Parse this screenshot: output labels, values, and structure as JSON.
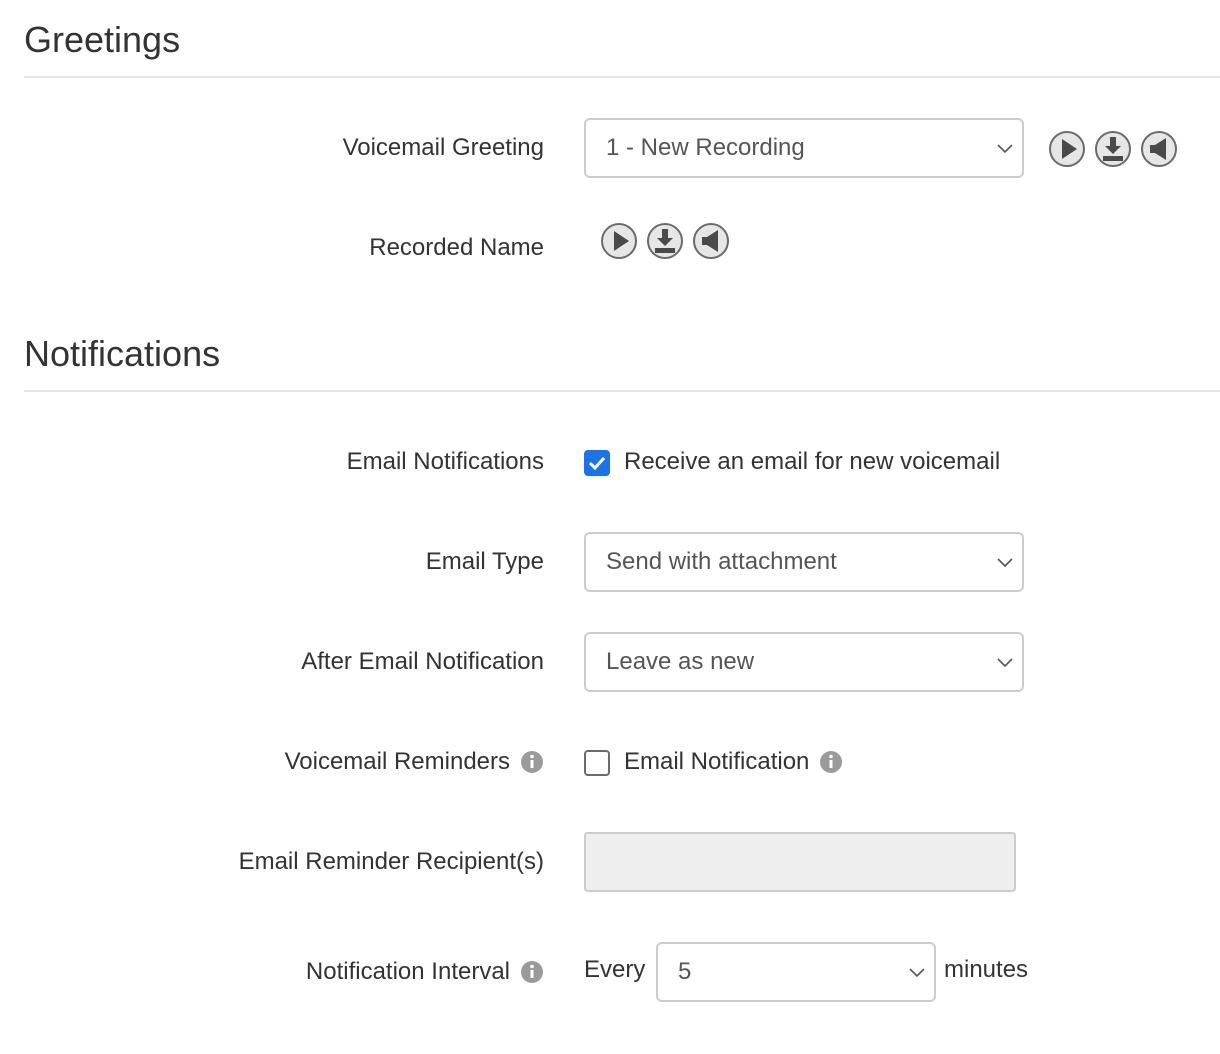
{
  "greetings": {
    "title": "Greetings",
    "voicemail_greeting": {
      "label": "Voicemail Greeting",
      "selected": "1 - New Recording",
      "actions": [
        "play-icon",
        "download-icon",
        "upload-icon"
      ]
    },
    "recorded_name": {
      "label": "Recorded Name",
      "actions": [
        "play-icon",
        "download-icon",
        "upload-icon"
      ]
    }
  },
  "notifications": {
    "title": "Notifications",
    "email_notifications": {
      "label": "Email Notifications",
      "checkbox_label": "Receive an email for new voicemail",
      "checked": true
    },
    "email_type": {
      "label": "Email Type",
      "selected": "Send with attachment"
    },
    "after_email_notification": {
      "label": "After Email Notification",
      "selected": "Leave as new"
    },
    "voicemail_reminders": {
      "label": "Voicemail Reminders",
      "checkbox_label": "Email Notification",
      "checked": false
    },
    "email_reminder_recipients": {
      "label": "Email Reminder Recipient(s)",
      "value": "",
      "disabled": true
    },
    "notification_interval": {
      "label": "Notification Interval",
      "prefix": "Every",
      "selected": "5",
      "suffix": "minutes"
    }
  },
  "colors": {
    "accent": "#1a73e8",
    "border": "#cccccc",
    "rule": "#e5e5e5",
    "disabled_bg": "#eeeeee",
    "icon_gray": "#6a6a6a"
  }
}
